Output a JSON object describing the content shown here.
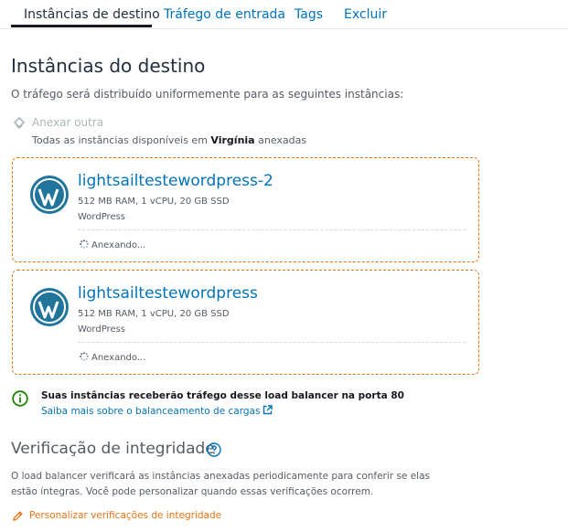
{
  "tabs": [
    {
      "label": "Instâncias de destino",
      "active": true
    },
    {
      "label": "Tráfego de entrada"
    },
    {
      "label": "Tags"
    },
    {
      "label": "Excluir"
    }
  ],
  "section": {
    "title": "Instâncias do destino",
    "description": "O tráfego será distribuído uniformemente para as seguintes instâncias:",
    "attach_label": "Anexar outra",
    "all_attached_prefix": "Todas as instâncias disponíveis em",
    "all_attached_region": "Virgínia",
    "all_attached_suffix": "anexadas"
  },
  "instances": [
    {
      "name": "lightsailtestewordpress-2",
      "specs": "512 MB RAM, 1 vCPU, 20 GB SSD",
      "blueprint": "WordPress",
      "status": "Anexando..."
    },
    {
      "name": "lightsailtestewordpress",
      "specs": "512 MB RAM, 1 vCPU, 20 GB SSD",
      "blueprint": "WordPress",
      "status": "Anexando..."
    }
  ],
  "info": {
    "title": "Suas instâncias receberão tráfego desse load balancer na porta 80",
    "link": "Saiba mais sobre o balanceamento de cargas"
  },
  "health": {
    "title": "Verificação de integridade",
    "description": "O load balancer verificará as instâncias anexadas periodicamente para conferir se elas estão íntegras. Você pode personalizar quando essas verificações ocorrem.",
    "customize_label": "Personalizar verificações de integridade"
  },
  "colors": {
    "accent": "#ec7211",
    "link": "#0073bb",
    "info": "#1d8102"
  }
}
